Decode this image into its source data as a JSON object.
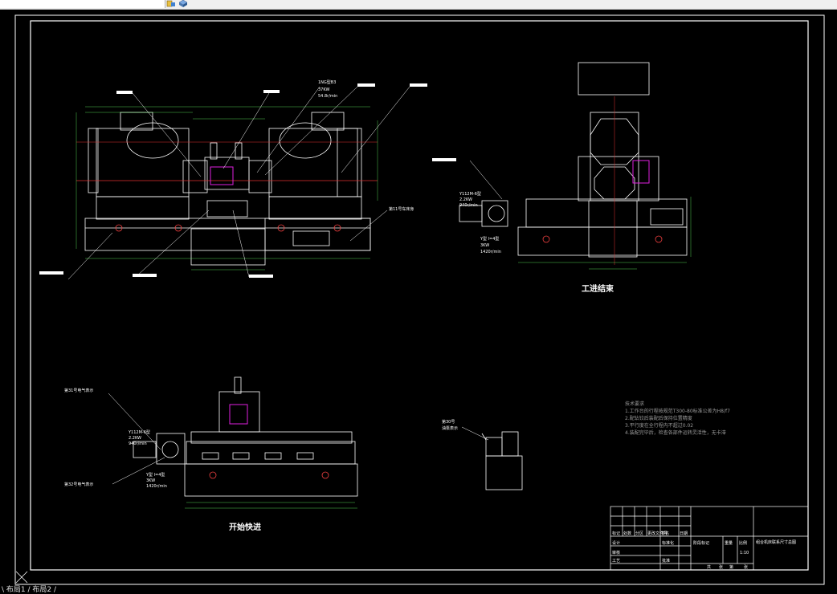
{
  "toolbar": {
    "icons": [
      "layer-tool-icon",
      "layer-cube-icon"
    ]
  },
  "drawing": {
    "views": {
      "front_caption": "",
      "side_caption": "工进结束",
      "start_caption": "开始快进"
    },
    "callouts": {
      "motor_top": "1NG型B3",
      "motor_top_power": "37KW",
      "motor_top_speed": "54.8r/min",
      "side_motor_model": "Y112M-6型",
      "side_motor_power": "2.2KW",
      "side_motor_speed": "940r/min",
      "side_motor2_model": "Y型 l=4型",
      "side_motor2_power": "3KW",
      "side_motor2_speed": "1420r/min",
      "front_base_note": "第11号车床身",
      "start_motor_model": "Y112M-6型",
      "start_motor_power": "2.2KW",
      "start_motor_speed": "940r/min",
      "start_motor2_model": "Y型 l=4型",
      "start_motor2_power": "3KW",
      "start_motor2_speed": "1420r/min",
      "start_label_a": "第31号电气表示",
      "start_label_b": "第32号电气表示",
      "pump_label_a": "第30号",
      "pump_label_b": "油泵表示"
    },
    "notes": {
      "title": "技术要求",
      "line1": "1.工作台的行程按规范T300-80标准公差为H8/f7",
      "line2": "2.配钻铰后装配后保持位置精度",
      "line3": "3.平行度在全行程内不超过0.02",
      "line4": "4.装配完毕后，检查各部件运转灵活性，无卡滞",
      "line5": "5.机床在全行程内不得有冲击现象"
    },
    "title_block": {
      "drawing_name": "组合机床联系尺寸总图",
      "scale": "1:10",
      "labels": [
        "标记",
        "处数",
        "分区",
        "更改文件号",
        "签名",
        "日期",
        "设计",
        "审核",
        "工艺",
        "标准化",
        "批准",
        "阶段标记",
        "重量",
        "比例",
        "共",
        "张",
        "第",
        "张"
      ]
    }
  },
  "status": {
    "tabs": "\\ 布局1 / 布局2 /"
  }
}
